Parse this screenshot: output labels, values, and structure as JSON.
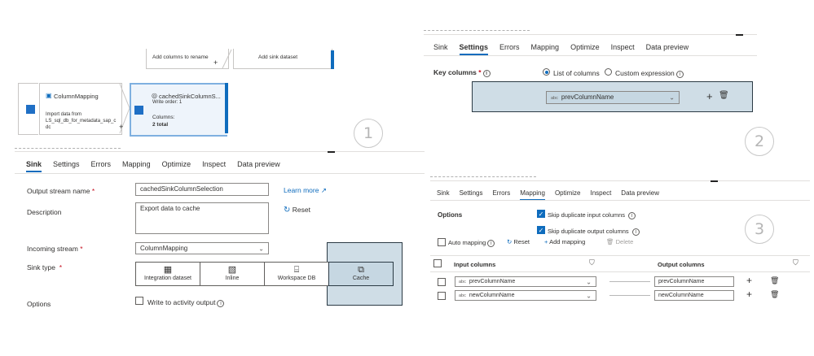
{
  "flow": {
    "add_columns": "Add columns to rename",
    "add_sink": "Add sink dataset",
    "column_mapping_title": "ColumnMapping",
    "column_mapping_desc": "Import data from LS_sql_db_for_metadata_sap_c dc",
    "plus1": "+",
    "plus2": "+",
    "cached_title": "cachedSinkColumnS...",
    "write_order": "Write order: 1",
    "columns_label": "Columns:",
    "columns_total": "2 total"
  },
  "markers": {
    "one": "1",
    "two": "2",
    "three": "3"
  },
  "panel1": {
    "tabs": [
      "Sink",
      "Settings",
      "Errors",
      "Mapping",
      "Optimize",
      "Inspect",
      "Data preview"
    ],
    "output_stream_label": "Output stream name",
    "output_stream_value": "cachedSinkColumnSelection",
    "learn_more": "Learn more",
    "description_label": "Description",
    "description_value": "Export data to cache",
    "reset": "Reset",
    "incoming_label": "Incoming stream",
    "incoming_value": "ColumnMapping",
    "sink_type_label": "Sink type",
    "sink_types": [
      "Integration dataset",
      "Inline",
      "Workspace DB",
      "Cache"
    ],
    "options_label": "Options",
    "write_activity": "Write to activity output"
  },
  "panel2": {
    "tabs": [
      "Sink",
      "Settings",
      "Errors",
      "Mapping",
      "Optimize",
      "Inspect",
      "Data preview"
    ],
    "key_columns_label": "Key columns",
    "radio_list": "List of columns",
    "radio_custom": "Custom expression",
    "abc": "abc",
    "column_value": "prevColumnName"
  },
  "panel3": {
    "tabs": [
      "Sink",
      "Settings",
      "Errors",
      "Mapping",
      "Optimize",
      "Inspect",
      "Data preview"
    ],
    "options_label": "Options",
    "skip_input": "Skip duplicate input columns",
    "skip_output": "Skip duplicate output columns",
    "auto_mapping": "Auto mapping",
    "reset": "Reset",
    "add_mapping": "Add mapping",
    "delete": "Delete",
    "input_columns": "Input columns",
    "output_columns": "Output columns",
    "rows": [
      {
        "abc": "abc",
        "input": "prevColumnName",
        "output": "prevColumnName"
      },
      {
        "abc": "abc",
        "input": "newColumnName",
        "output": "newColumnName"
      }
    ]
  }
}
